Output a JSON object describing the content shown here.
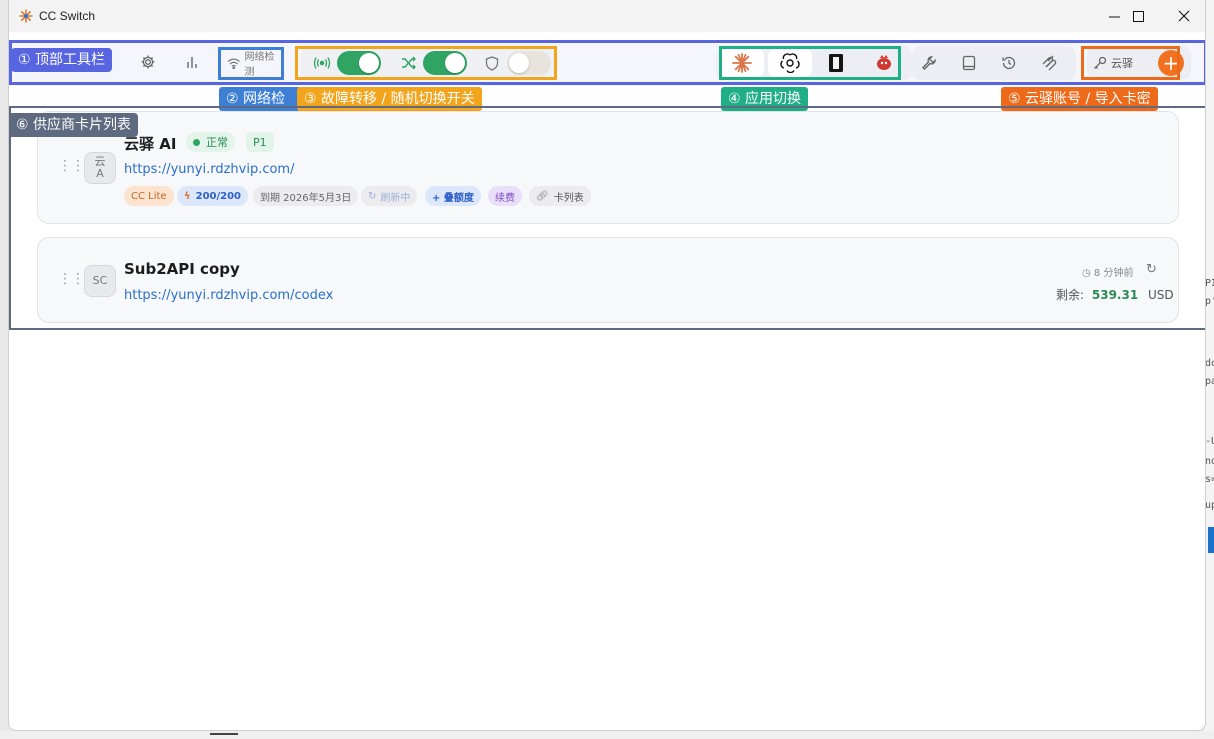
{
  "window": {
    "title": "CC Switch"
  },
  "toolbar": {
    "net_check_label": "网络检测",
    "account_label": "云驿",
    "add_label": "+"
  },
  "annotations": {
    "a1": "① 顶部工具栏",
    "a2": "② 网络检",
    "a3": "③ 故障转移 / 随机切换开关",
    "a4": "④ 应用切换",
    "a5": "⑤ 云驿账号 / 导入卡密",
    "a6": "⑥ 供应商卡片列表"
  },
  "providers": [
    {
      "avatar_line1": "云",
      "avatar_line2": "A",
      "name": "云驿 AI",
      "status": "正常",
      "priority": "P1",
      "url": "https://yunyi.rdzhvip.com/",
      "tags": {
        "plan": "CC Lite",
        "quota": "200/200",
        "expiry": "到期 2026年5月3日",
        "refreshing": "刷新中",
        "add_quota": "+ 叠额度",
        "renew": "续费",
        "card_list": "卡列表"
      }
    },
    {
      "avatar": "SC",
      "name": "Sub2API copy",
      "url": "https://yunyi.rdzhvip.com/codex",
      "updated": "8 分钟前",
      "balance_label": "剩余:",
      "balance_value": "539.31",
      "balance_unit": "USD"
    }
  ],
  "colors": {
    "accent_orange": "#f37221",
    "toggle_green": "#2fa463",
    "link_blue": "#2a6ec9",
    "ann_blue": "#5865e0",
    "ann_orange": "#f2a41c",
    "ann_teal": "#1fae86",
    "ann_red": "#ee6a1b",
    "ann_gray": "#5e6a80"
  }
}
